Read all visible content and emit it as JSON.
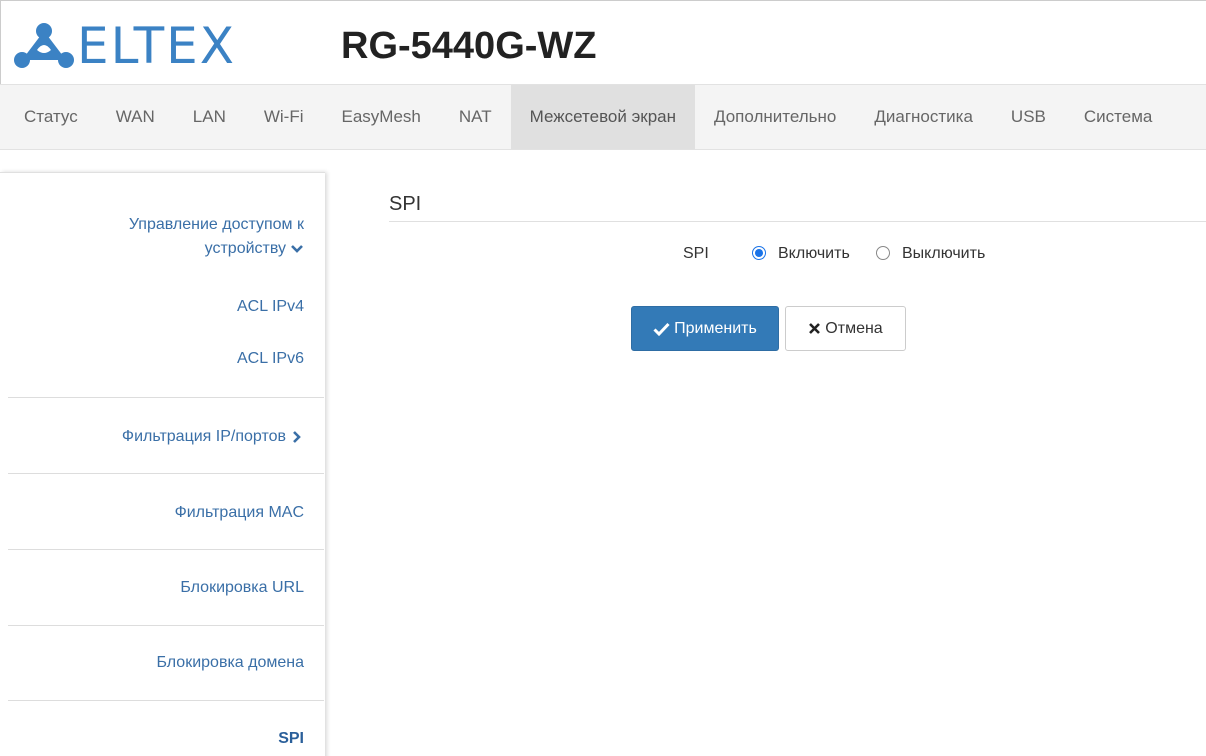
{
  "header": {
    "logo_text": "ELTEX",
    "model": "RG-5440G-WZ"
  },
  "nav": [
    {
      "label": "Статус"
    },
    {
      "label": "WAN"
    },
    {
      "label": "LAN"
    },
    {
      "label": "Wi-Fi"
    },
    {
      "label": "EasyMesh"
    },
    {
      "label": "NAT"
    },
    {
      "label": "Межсетевой экран",
      "active": true
    },
    {
      "label": "Дополнительно"
    },
    {
      "label": "Диагностика"
    },
    {
      "label": "USB"
    },
    {
      "label": "Система"
    }
  ],
  "sidebar": {
    "access_line1": "Управление доступом к",
    "access_line2": "устройству",
    "acl_ipv4": "ACL IPv4",
    "acl_ipv6": "ACL IPv6",
    "ip_port_filter": "Фильтрация IP/портов",
    "mac_filter": "Фильтрация MAC",
    "url_block": "Блокировка URL",
    "domain_block": "Блокировка домена",
    "spi": "SPI"
  },
  "content": {
    "title": "SPI",
    "field_label": "SPI",
    "radio_enable": "Включить",
    "radio_disable": "Выключить",
    "selected": "enable",
    "apply_label": "Применить",
    "cancel_label": "Отмена"
  },
  "colors": {
    "brand": "#3b82c4",
    "link": "#3a6fa7",
    "primary_button": "#337ab7"
  },
  "icons": {
    "logo": "eltex-logo-icon",
    "chevron_down": "chevron-down-icon",
    "chevron_right": "chevron-right-icon",
    "check": "check-icon",
    "close": "close-icon"
  }
}
